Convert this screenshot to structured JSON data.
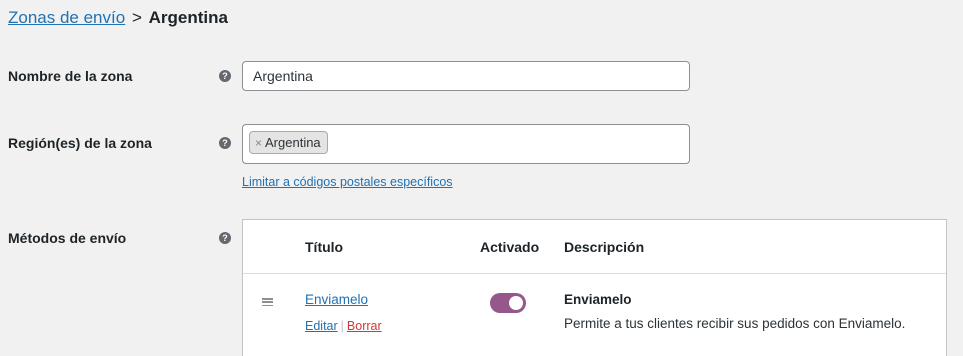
{
  "breadcrumb": {
    "parent_label": "Zonas de envío",
    "separator": ">",
    "current": "Argentina"
  },
  "zone_name": {
    "label": "Nombre de la zona",
    "help": "?",
    "value": "Argentina"
  },
  "zone_regions": {
    "label": "Región(es) de la zona",
    "help": "?",
    "tokens": [
      {
        "remove": "×",
        "label": "Argentina"
      }
    ],
    "zip_link": "Limitar a códigos postales específicos"
  },
  "shipping_methods": {
    "label": "Métodos de envío",
    "help": "?",
    "columns": {
      "title": "Título",
      "enabled": "Activado",
      "description": "Descripción"
    },
    "rows": [
      {
        "title": "Enviamelo",
        "edit": "Editar",
        "divider": "|",
        "delete": "Borrar",
        "enabled": true,
        "desc_title": "Enviamelo",
        "desc_text": "Permite a tus clientes recibir sus pedidos con Enviamelo."
      }
    ]
  },
  "colors": {
    "link": "#2271b1",
    "toggle_on": "#96588a",
    "delete": "#d63638",
    "background": "#f1f1f1"
  }
}
